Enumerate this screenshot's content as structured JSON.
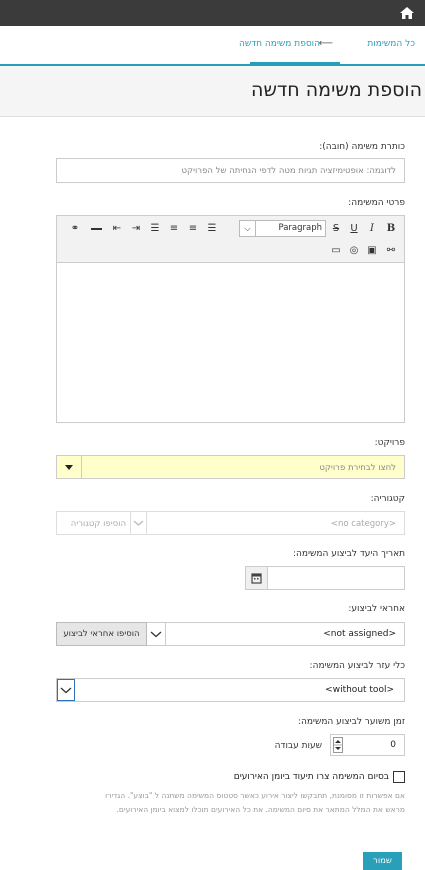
{
  "header": {
    "home_icon": "home-icon",
    "tab_all_tasks": "כל המשימות",
    "tab_add_task": "הוספת משימה חדשה",
    "arrow": "⟵"
  },
  "page": {
    "title": "הוספת משימה חדשה"
  },
  "form": {
    "title_label": "כותרת משימה (חובה):",
    "title_placeholder": "לדוגמה: אופטימיזציה תגיות מטה לדפי הנחיתה של הפרויקט",
    "details_label": "פרטי המשימה:",
    "format_select": "Paragraph",
    "project_label": "פרויקט:",
    "project_placeholder": "לחצו לבחירת פרויקט",
    "category_label": "קטגוריה:",
    "category_placeholder": "<no category>",
    "category_add_placeholder": "הוסיפו קטגוריה",
    "due_label": "תאריך היעד לביצוע המשימה:",
    "assignee_label": "אחראי לביצוע:",
    "assignee_value": "<not assigned>",
    "assignee_button": "הוסיפו אחראי לביצוע",
    "tool_label": "כלי עזר לביצוע המשימה:",
    "tool_value": "<without tool>",
    "estimate_label": "זמן משוער לביצוע המשימה:",
    "estimate_value": "0",
    "estimate_unit": "שעות עבודה",
    "checkbox_label": "בסיום המשימה צרו תיעוד ביומן האירועים",
    "note_line1": "אם אפשרות זו מסומנת, תתבקשו ליצור אירוע כאשר סטטוס המשימה משתנה ל \"בוצע\". הגדירו",
    "note_line2": "מראש את המלל המתאר את סיום המשימה. את כל האירועים תוכלו למצוא ביומן האירועים.",
    "save_button": "שמור"
  },
  "colors": {
    "accent": "#2a9fb9",
    "topbar": "#3b3b3b",
    "project_bg": "#ffffcc"
  }
}
